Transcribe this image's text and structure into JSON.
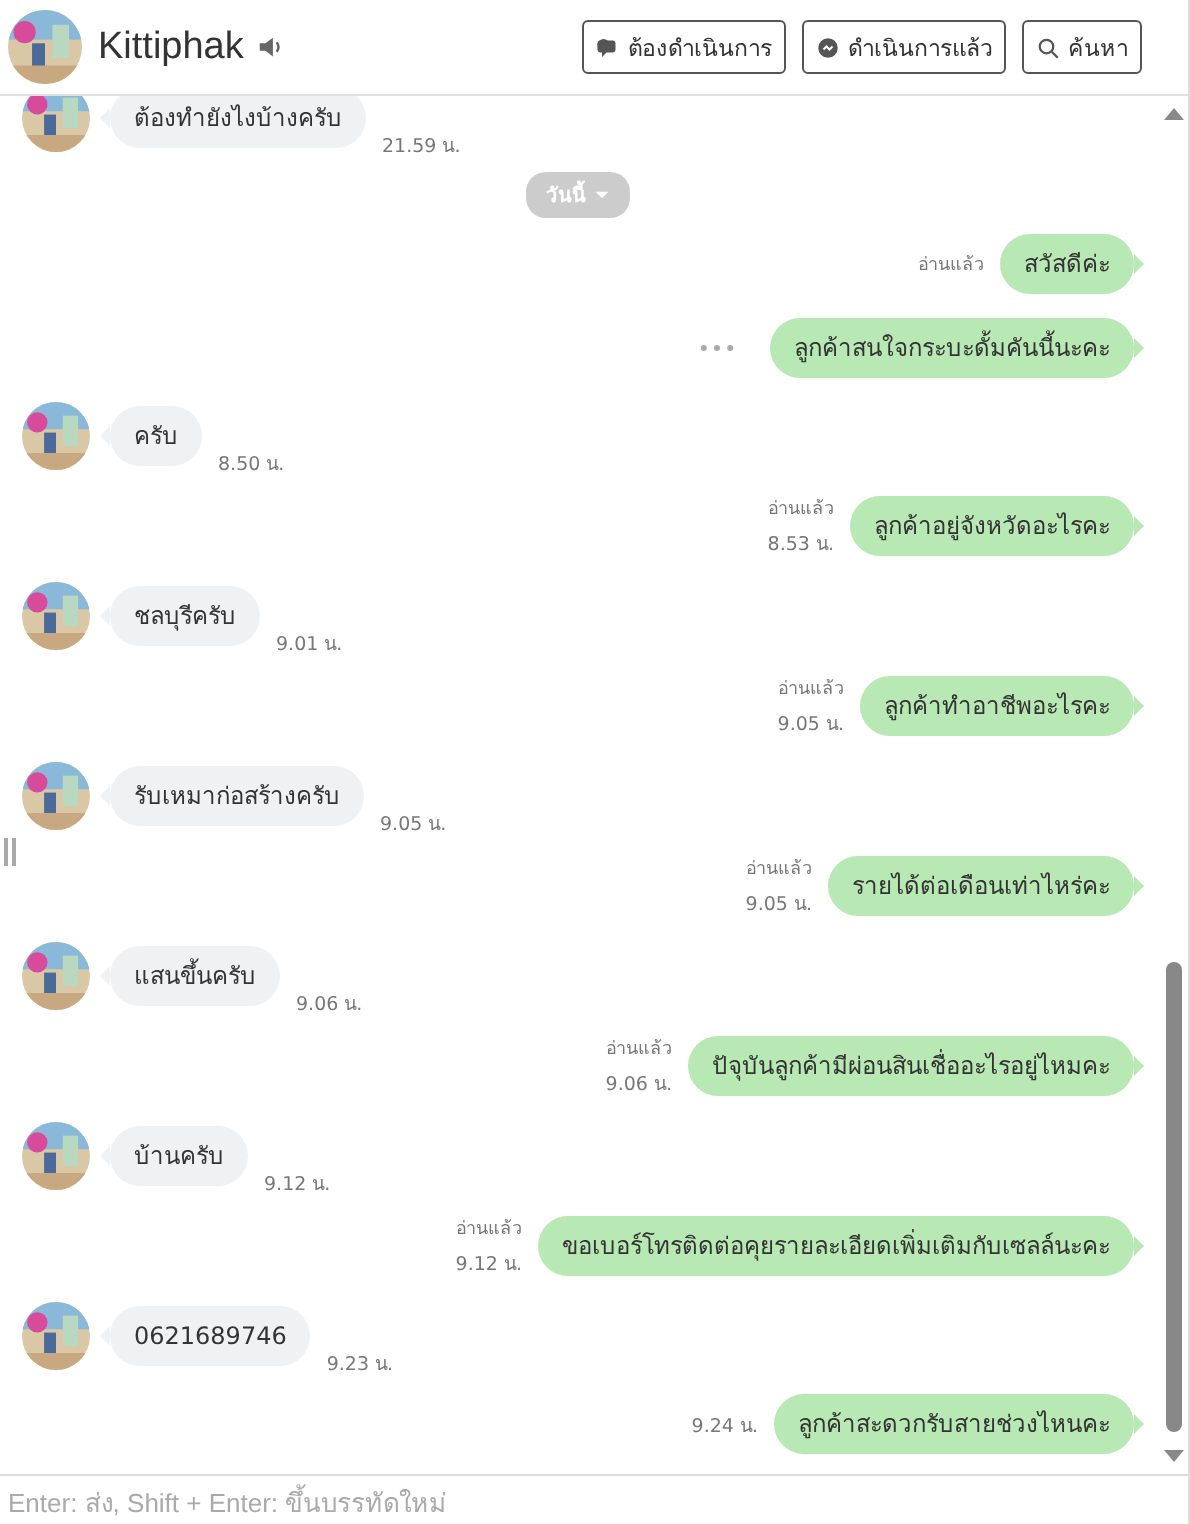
{
  "header": {
    "contact_name": "Kittiphak",
    "buttons": [
      {
        "label": "ต้องดำเนินการ",
        "kind": "todo"
      },
      {
        "label": "ดำเนินการแล้ว",
        "kind": "done"
      },
      {
        "label": "ค้นหา",
        "kind": "search"
      }
    ]
  },
  "messages": [
    {
      "kind": "incoming",
      "text": "ต้องทำยังไงบ้างครับ",
      "time": "21.59 น."
    },
    {
      "kind": "date",
      "text": "วันนี้"
    },
    {
      "kind": "outgoing",
      "text": "สวัสดีค่ะ",
      "read": "อ่านแล้ว"
    },
    {
      "kind": "outgoing",
      "text": "ลูกค้าสนใจกระบะดั้มคันนี้นะคะ",
      "menu": true
    },
    {
      "kind": "incoming",
      "text": "ครับ",
      "time": "8.50 น."
    },
    {
      "kind": "outgoing",
      "text": "ลูกค้าอยู่จังหวัดอะไรคะ",
      "read": "อ่านแล้ว",
      "time": "8.53 น."
    },
    {
      "kind": "incoming",
      "text": "ชลบุรีครับ",
      "time": "9.01 น."
    },
    {
      "kind": "outgoing",
      "text": "ลูกค้าทำอาชีพอะไรคะ",
      "read": "อ่านแล้ว",
      "time": "9.05 น."
    },
    {
      "kind": "incoming",
      "text": "รับเหมาก่อสร้างครับ",
      "time": "9.05 น."
    },
    {
      "kind": "outgoing",
      "text": "รายได้ต่อเดือนเท่าไหร่คะ",
      "read": "อ่านแล้ว",
      "time": "9.05 น."
    },
    {
      "kind": "incoming",
      "text": "แสนขึ้นครับ",
      "time": "9.06 น."
    },
    {
      "kind": "outgoing",
      "text": "ปัจุบันลูกค้ามีผ่อนสินเชื่ออะไรอยู่ไหมคะ",
      "read": "อ่านแล้ว",
      "time": "9.06 น."
    },
    {
      "kind": "incoming",
      "text": "บ้านครับ",
      "time": "9.12 น."
    },
    {
      "kind": "outgoing",
      "text": "ขอเบอร์โทรติดต่อคุยรายละเอียดเพิ่มเติมกับเซลล์นะคะ",
      "read": "อ่านแล้ว",
      "time": "9.12 น."
    },
    {
      "kind": "incoming",
      "text": "0621689746",
      "time": "9.23 น."
    },
    {
      "kind": "outgoing",
      "text": "ลูกค้าสะดวกรับสายช่วงไหนคะ",
      "time": "9.24 น."
    }
  ],
  "composer": {
    "placeholder": "Enter: ส่ง, Shift + Enter: ขึ้นบรรทัดใหม่"
  }
}
